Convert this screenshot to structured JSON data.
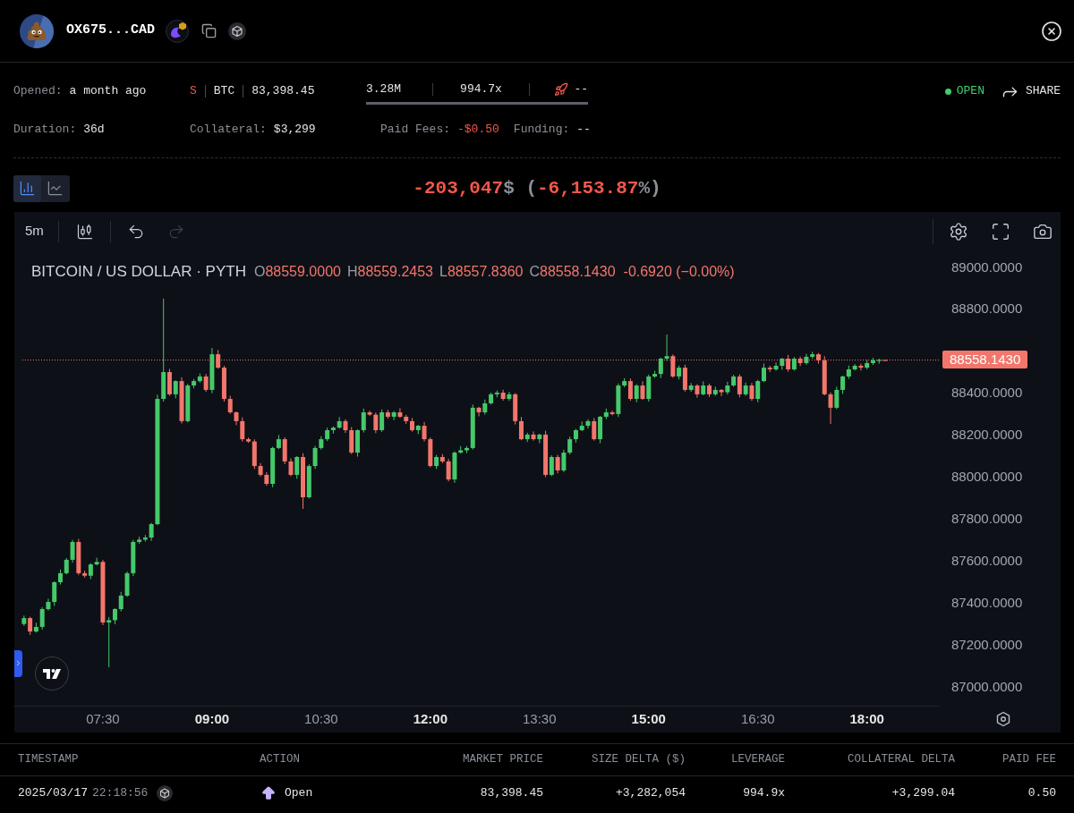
{
  "header": {
    "address": "OX675...CAD"
  },
  "summary": {
    "opened": {
      "label": "Opened:",
      "value": "a month ago"
    },
    "position": {
      "side": {
        "label": "S",
        "negative": true
      },
      "asset": "BTC",
      "entry_price": "83,398.45"
    },
    "metrics": [
      {
        "kind": "text",
        "value": "3.28M"
      },
      {
        "kind": "text",
        "value": "994.7x"
      },
      {
        "kind": "rocket",
        "value": "--"
      }
    ],
    "status": "OPEN",
    "share": "SHARE",
    "details": [
      {
        "label": "Duration:",
        "value": "36d",
        "negative": false
      },
      {
        "label": "Collateral:",
        "value": "$3,299",
        "negative": false
      },
      {
        "label": "Paid Fees:",
        "value": "-$0.50",
        "negative": true
      },
      {
        "label": "Funding:",
        "value": "--",
        "negative": false
      }
    ]
  },
  "chart_view": [
    {
      "kind": "bars",
      "selected": true
    },
    {
      "kind": "line",
      "selected": false
    }
  ],
  "pnl": [
    {
      "text": "-203,047",
      "negative": true
    },
    {
      "text": "$ (",
      "negative": false
    },
    {
      "text": "-6,153.87",
      "negative": true
    },
    {
      "text": "%)",
      "negative": false
    }
  ],
  "chart": {
    "interval": "5m",
    "tools": [
      {
        "kind": "candles"
      },
      {
        "kind": "undo",
        "disabled": false
      },
      {
        "kind": "redo",
        "disabled": true
      }
    ],
    "actions": [
      {
        "kind": "settings"
      },
      {
        "kind": "fullscreen"
      },
      {
        "kind": "camera"
      }
    ],
    "legend": {
      "symbol": "BITCOIN / US DOLLAR · PYTH",
      "negative": true,
      "ohlc": [
        {
          "key": "O",
          "value": "88559.0000"
        },
        {
          "key": "H",
          "value": "88559.2453"
        },
        {
          "key": "L",
          "value": "88557.8360"
        },
        {
          "key": "C",
          "value": "88558.1430"
        }
      ],
      "change": "-0.6920 (−0.00%)"
    },
    "xtick_styles": [
      {
        "bold": false
      },
      {
        "bold": true
      },
      {
        "bold": false
      },
      {
        "bold": true
      },
      {
        "bold": false
      },
      {
        "bold": true
      },
      {
        "bold": false
      },
      {
        "bold": true
      }
    ],
    "chart_data": {
      "type": "candlestick",
      "xlim": [
        377,
        1140
      ],
      "ylim": [
        87000,
        89000
      ],
      "yticks": [
        {
          "value": 89000,
          "label": "89000.0000"
        },
        {
          "value": 88800,
          "label": "88800.0000"
        },
        {
          "value": 88400,
          "label": "88400.0000"
        },
        {
          "value": 88200,
          "label": "88200.0000"
        },
        {
          "value": 88000,
          "label": "88000.0000"
        },
        {
          "value": 87800,
          "label": "87800.0000"
        },
        {
          "value": 87600,
          "label": "87600.0000"
        },
        {
          "value": 87400,
          "label": "87400.0000"
        },
        {
          "value": 87200,
          "label": "87200.0000"
        },
        {
          "value": 87000,
          "label": "87000.0000"
        }
      ],
      "xticks": [
        {
          "value": 450,
          "label": "07:30"
        },
        {
          "value": 540,
          "label": "09:00"
        },
        {
          "value": 630,
          "label": "10:30"
        },
        {
          "value": 720,
          "label": "12:00"
        },
        {
          "value": 810,
          "label": "13:30"
        },
        {
          "value": 900,
          "label": "15:00"
        },
        {
          "value": 990,
          "label": "16:30"
        },
        {
          "value": 1080,
          "label": "18:00"
        }
      ],
      "ref_lines": [
        {
          "axis": "y",
          "value": 88558.143,
          "label": "88558.1430"
        }
      ],
      "x": [
        385,
        390,
        395,
        400,
        405,
        410,
        415,
        420,
        425,
        430,
        435,
        440,
        445,
        450,
        455,
        460,
        465,
        470,
        475,
        480,
        485,
        490,
        495,
        500,
        505,
        510,
        515,
        520,
        525,
        530,
        535,
        540,
        545,
        550,
        555,
        560,
        565,
        570,
        575,
        580,
        585,
        590,
        595,
        600,
        605,
        610,
        615,
        620,
        625,
        630,
        635,
        640,
        645,
        650,
        655,
        660,
        665,
        670,
        675,
        680,
        685,
        690,
        695,
        700,
        705,
        710,
        715,
        720,
        725,
        730,
        735,
        740,
        745,
        750,
        755,
        760,
        765,
        770,
        775,
        780,
        785,
        790,
        795,
        800,
        805,
        810,
        815,
        820,
        825,
        830,
        835,
        840,
        845,
        850,
        855,
        860,
        865,
        870,
        875,
        880,
        885,
        890,
        895,
        900,
        905,
        910,
        915,
        920,
        925,
        930,
        935,
        940,
        945,
        950,
        955,
        960,
        965,
        970,
        975,
        980,
        985,
        990,
        995,
        1000,
        1005,
        1010,
        1015,
        1020,
        1025,
        1030,
        1035,
        1040,
        1045,
        1050,
        1055,
        1060,
        1065,
        1070,
        1075,
        1080,
        1085,
        1090,
        1095
      ],
      "ohlc": [
        [
          87300,
          87340,
          87291,
          87328
        ],
        [
          87328,
          87334,
          87248,
          87264
        ],
        [
          87264,
          87306,
          87259,
          87286
        ],
        [
          87286,
          87380,
          87273,
          87371
        ],
        [
          87371,
          87420,
          87364,
          87405
        ],
        [
          87405,
          87503,
          87386,
          87499
        ],
        [
          87499,
          87560,
          87488,
          87542
        ],
        [
          87542,
          87614,
          87536,
          87606
        ],
        [
          87606,
          87701,
          87592,
          87691
        ],
        [
          87691,
          87705,
          87534,
          87542
        ],
        [
          87542,
          87554,
          87521,
          87530
        ],
        [
          87530,
          87590,
          87514,
          87584
        ],
        [
          87584,
          87616,
          87579,
          87596
        ],
        [
          87596,
          87605,
          87294,
          87307
        ],
        [
          87307,
          87333,
          87094,
          87318
        ],
        [
          87318,
          87375,
          87299,
          87371
        ],
        [
          87371,
          87453,
          87360,
          87435
        ],
        [
          87435,
          87550,
          87429,
          87542
        ],
        [
          87542,
          87701,
          87528,
          87691
        ],
        [
          87691,
          87716,
          87683,
          87702
        ],
        [
          87702,
          87724,
          87693,
          87712
        ],
        [
          87712,
          87782,
          87696,
          87776
        ],
        [
          87776,
          88393,
          87771,
          88373
        ],
        [
          88373,
          88851,
          88360,
          88501
        ],
        [
          88501,
          88516,
          88388,
          88395
        ],
        [
          88395,
          88462,
          88376,
          88458
        ],
        [
          88458,
          88476,
          88256,
          88267
        ],
        [
          88267,
          88445,
          88261,
          88437
        ],
        [
          88437,
          88468,
          88423,
          88458
        ],
        [
          88458,
          88494,
          88450,
          88480
        ],
        [
          88480,
          88492,
          88407,
          88416
        ],
        [
          88416,
          88616,
          88400,
          88586
        ],
        [
          88586,
          88606,
          88517,
          88522
        ],
        [
          88522,
          88531,
          88360,
          88373
        ],
        [
          88373,
          88388,
          88302,
          88309
        ],
        [
          88309,
          88313,
          88248,
          88267
        ],
        [
          88267,
          88285,
          88170,
          88181
        ],
        [
          88181,
          88189,
          88164,
          88170
        ],
        [
          88170,
          88180,
          88039,
          88053
        ],
        [
          88053,
          88067,
          88003,
          88011
        ],
        [
          88011,
          88023,
          87959,
          87968
        ],
        [
          87968,
          88145,
          87952,
          88139
        ],
        [
          88139,
          88201,
          88134,
          88181
        ],
        [
          88181,
          88190,
          88062,
          88075
        ],
        [
          88075,
          88090,
          88004,
          88011
        ],
        [
          88011,
          88100,
          87992,
          88096
        ],
        [
          88096,
          88114,
          87849,
          87904
        ],
        [
          87904,
          88061,
          87898,
          88053
        ],
        [
          88053,
          88149,
          88039,
          88139
        ],
        [
          88139,
          88195,
          88131,
          88181
        ],
        [
          88181,
          88236,
          88172,
          88224
        ],
        [
          88224,
          88242,
          88208,
          88236
        ],
        [
          88236,
          88287,
          88231,
          88267
        ],
        [
          88267,
          88276,
          88211,
          88224
        ],
        [
          88224,
          88239,
          88110,
          88117
        ],
        [
          88117,
          88228,
          88098,
          88224
        ],
        [
          88224,
          88327,
          88213,
          88309
        ],
        [
          88309,
          88317,
          88292,
          88298
        ],
        [
          88298,
          88308,
          88210,
          88224
        ],
        [
          88224,
          88323,
          88216,
          88309
        ],
        [
          88309,
          88321,
          88279,
          88288
        ],
        [
          88288,
          88315,
          88272,
          88309
        ],
        [
          88309,
          88329,
          88283,
          88288
        ],
        [
          88288,
          88297,
          88254,
          88267
        ],
        [
          88267,
          88282,
          88217,
          88224
        ],
        [
          88224,
          88249,
          88205,
          88245
        ],
        [
          88245,
          88263,
          88170,
          88181
        ],
        [
          88181,
          88189,
          88047,
          88053
        ],
        [
          88053,
          88106,
          88039,
          88096
        ],
        [
          88096,
          88110,
          88067,
          88075
        ],
        [
          88075,
          88087,
          87980,
          87989
        ],
        [
          87989,
          88123,
          87973,
          88117
        ],
        [
          88117,
          88148,
          88112,
          88128
        ],
        [
          88128,
          88148,
          88115,
          88139
        ],
        [
          88139,
          88346,
          88132,
          88331
        ],
        [
          88331,
          88335,
          88290,
          88309
        ],
        [
          88309,
          88370,
          88298,
          88352
        ],
        [
          88352,
          88403,
          88346,
          88395
        ],
        [
          88395,
          88413,
          88381,
          88403
        ],
        [
          88403,
          88417,
          88365,
          88373
        ],
        [
          88373,
          88407,
          88364,
          88395
        ],
        [
          88395,
          88401,
          88251,
          88267
        ],
        [
          88267,
          88287,
          88176,
          88181
        ],
        [
          88181,
          88212,
          88168,
          88203
        ],
        [
          88203,
          88218,
          88174,
          88181
        ],
        [
          88181,
          88207,
          88162,
          88203
        ],
        [
          88203,
          88221,
          88000,
          88011
        ],
        [
          88011,
          88104,
          88005,
          88096
        ],
        [
          88096,
          88106,
          88018,
          88032
        ],
        [
          88032,
          88131,
          88024,
          88117
        ],
        [
          88117,
          88193,
          88108,
          88181
        ],
        [
          88181,
          88230,
          88165,
          88224
        ],
        [
          88224,
          88265,
          88219,
          88245
        ],
        [
          88245,
          88276,
          88232,
          88267
        ],
        [
          88267,
          88282,
          88174,
          88181
        ],
        [
          88181,
          88292,
          88162,
          88288
        ],
        [
          88288,
          88327,
          88277,
          88309
        ],
        [
          88309,
          88317,
          88295,
          88301
        ],
        [
          88301,
          88447,
          88287,
          88437
        ],
        [
          88437,
          88472,
          88429,
          88458
        ],
        [
          88458,
          88470,
          88364,
          88373
        ],
        [
          88373,
          88443,
          88357,
          88437
        ],
        [
          88437,
          88457,
          88368,
          88373
        ],
        [
          88373,
          88489,
          88360,
          88480
        ],
        [
          88480,
          88507,
          88473,
          88492
        ],
        [
          88492,
          88569,
          88473,
          88565
        ],
        [
          88565,
          88680,
          88554,
          88577
        ],
        [
          88577,
          88585,
          88474,
          88480
        ],
        [
          88480,
          88532,
          88466,
          88522
        ],
        [
          88522,
          88536,
          88408,
          88416
        ],
        [
          88416,
          88449,
          88407,
          88437
        ],
        [
          88437,
          88443,
          88379,
          88395
        ],
        [
          88395,
          88457,
          88390,
          88437
        ],
        [
          88437,
          88446,
          88382,
          88395
        ],
        [
          88395,
          88431,
          88388,
          88416
        ],
        [
          88416,
          88420,
          88386,
          88405
        ],
        [
          88405,
          88455,
          88394,
          88437
        ],
        [
          88437,
          88488,
          88431,
          88480
        ],
        [
          88480,
          88490,
          88381,
          88395
        ],
        [
          88395,
          88451,
          88387,
          88437
        ],
        [
          88437,
          88449,
          88364,
          88373
        ],
        [
          88373,
          88464,
          88357,
          88458
        ],
        [
          88458,
          88542,
          88453,
          88522
        ],
        [
          88522,
          88531,
          88501,
          88514
        ],
        [
          88514,
          88546,
          88507,
          88531
        ],
        [
          88531,
          88569,
          88512,
          88565
        ],
        [
          88565,
          88583,
          88503,
          88514
        ],
        [
          88514,
          88573,
          88508,
          88565
        ],
        [
          88565,
          88575,
          88530,
          88544
        ],
        [
          88544,
          88588,
          88536,
          88574
        ],
        [
          88574,
          88598,
          88565,
          88586
        ],
        [
          88586,
          88592,
          88541,
          88557
        ],
        [
          88557,
          88577,
          88390,
          88395
        ],
        [
          88395,
          88404,
          88254,
          88331
        ],
        [
          88331,
          88431,
          88324,
          88416
        ],
        [
          88416,
          88484,
          88397,
          88480
        ],
        [
          88480,
          88532,
          88469,
          88514
        ],
        [
          88514,
          88539,
          88508,
          88531
        ],
        [
          88531,
          88541,
          88508,
          88522
        ],
        [
          88522,
          88558,
          88514,
          88544
        ],
        [
          88544,
          88569,
          88535,
          88557
        ],
        [
          88557,
          88565,
          88541,
          88559
        ],
        [
          88559,
          88559.2453,
          88557.836,
          88558.143
        ]
      ]
    }
  },
  "table": {
    "columns": [
      "TIMESTAMP",
      "ACTION",
      "MARKET PRICE",
      "SIZE DELTA ($)",
      "LEVERAGE",
      "COLLATERAL DELTA",
      "PAID FEE"
    ],
    "rows": [
      {
        "date": "2025/03/17",
        "time": "22:18:56",
        "action": "Open",
        "market_price": "83,398.45",
        "size_delta": "+3,282,054",
        "leverage": "994.9x",
        "collateral_delta": "+3,299.04",
        "paid_fee": "0.50"
      }
    ]
  }
}
